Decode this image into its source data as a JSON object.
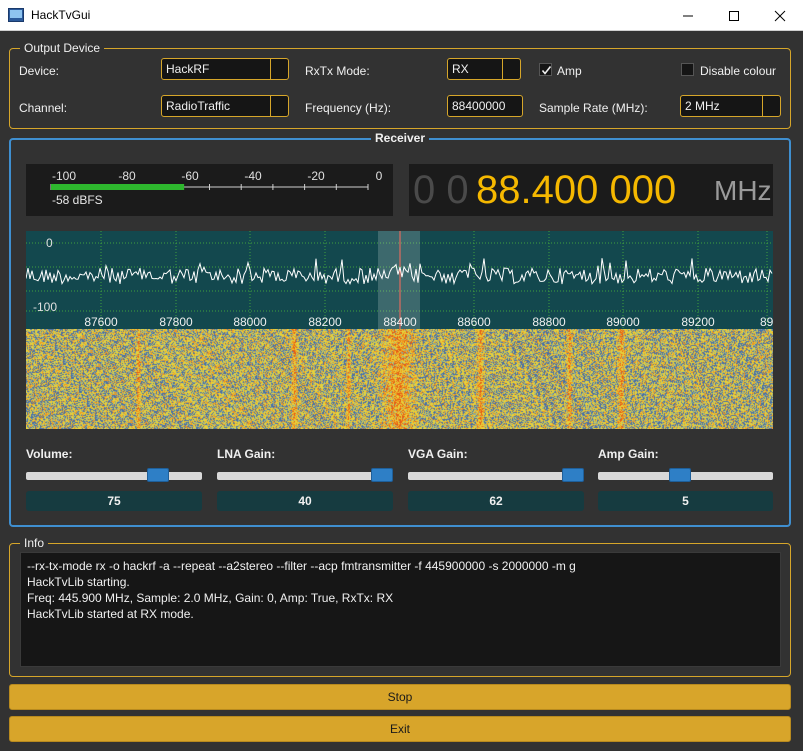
{
  "window": {
    "title": "HackTvGui"
  },
  "output_device": {
    "group_title": "Output Device",
    "device_label": "Device:",
    "device_value": "HackRF",
    "rxtx_label": "RxTx Mode:",
    "rxtx_value": "RX",
    "amp_label": "Amp",
    "amp_checked": true,
    "disable_colour_label": "Disable colour",
    "disable_colour_checked": false,
    "channel_label": "Channel:",
    "channel_value": "RadioTraffic",
    "frequency_label": "Frequency (Hz):",
    "frequency_value": "88400000",
    "sample_rate_label": "Sample Rate (MHz):",
    "sample_rate_value": "2 MHz"
  },
  "receiver": {
    "group_title": "Receiver",
    "meter": {
      "scale": [
        "-100",
        "-80",
        "-60",
        "-40",
        "-20",
        "0"
      ],
      "level_fraction": 0.42,
      "readout": "-58 dBFS"
    },
    "freq_display": {
      "dim_digits": "0 0",
      "main": "88.400 000",
      "unit": "MHz"
    },
    "spectrum": {
      "y_ticks": [
        "0",
        "-100"
      ],
      "x_ticks": [
        "87600",
        "87800",
        "88000",
        "88200",
        "88400",
        "88600",
        "88800",
        "89000",
        "89200",
        "89"
      ],
      "center_freq_khz": 88400
    },
    "sliders": [
      {
        "label": "Volume:",
        "value": "75",
        "fraction": 0.75
      },
      {
        "label": "LNA Gain:",
        "value": "40",
        "fraction": 1.0
      },
      {
        "label": "VGA Gain:",
        "value": "62",
        "fraction": 0.99
      },
      {
        "label": "Amp Gain:",
        "value": "5",
        "fraction": 0.47
      }
    ]
  },
  "info": {
    "group_title": "Info",
    "lines": [
      "--rx-tx-mode rx -o hackrf -a --repeat --a2stereo --filter --acp fmtransmitter -f 445900000 -s 2000000 -m g",
      "HackTvLib starting.",
      "Freq: 445.900 MHz, Sample: 2.0 MHz, Gain: 0, Amp: True, RxTx: RX",
      "HackTvLib started at RX mode."
    ]
  },
  "buttons": {
    "stop": "Stop",
    "exit": "Exit"
  },
  "colors": {
    "accent": "#d6a62a",
    "receiver_border": "#3f8fd0",
    "freq_digits": "#f5b800",
    "meter_bar": "#2eb82e"
  },
  "icons": {
    "app": "app-icon",
    "minimize": "minimize-icon",
    "maximize": "maximize-icon",
    "close": "close-icon"
  }
}
